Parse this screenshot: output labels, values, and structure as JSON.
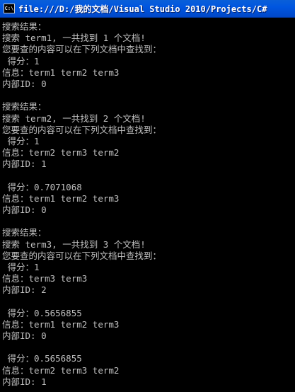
{
  "window": {
    "title": "file:///D:/我的文档/Visual Studio 2010/Projects/C#",
    "icon_label": "C:\\",
    "icon": "console-icon"
  },
  "console": {
    "lines": [
      "搜索结果：",
      "搜索 term1, 一共找到 1 个文档!",
      "您要查的内容可以在下列文档中查找到：",
      " 得分：1",
      "信息：term1 term2 term3",
      "内部ID: 0",
      "",
      "搜索结果：",
      "搜索 term2, 一共找到 2 个文档!",
      "您要查的内容可以在下列文档中查找到：",
      " 得分：1",
      "信息：term2 term3 term2",
      "内部ID: 1",
      "",
      " 得分：0.7071068",
      "信息：term1 term2 term3",
      "内部ID: 0",
      "",
      "搜索结果：",
      "搜索 term3, 一共找到 3 个文档!",
      "您要查的内容可以在下列文档中查找到：",
      " 得分：1",
      "信息：term3 term3",
      "内部ID: 2",
      "",
      " 得分：0.5656855",
      "信息：term1 term2 term3",
      "内部ID: 0",
      "",
      " 得分：0.5656855",
      "信息：term2 term3 term2",
      "内部ID: 1"
    ]
  }
}
